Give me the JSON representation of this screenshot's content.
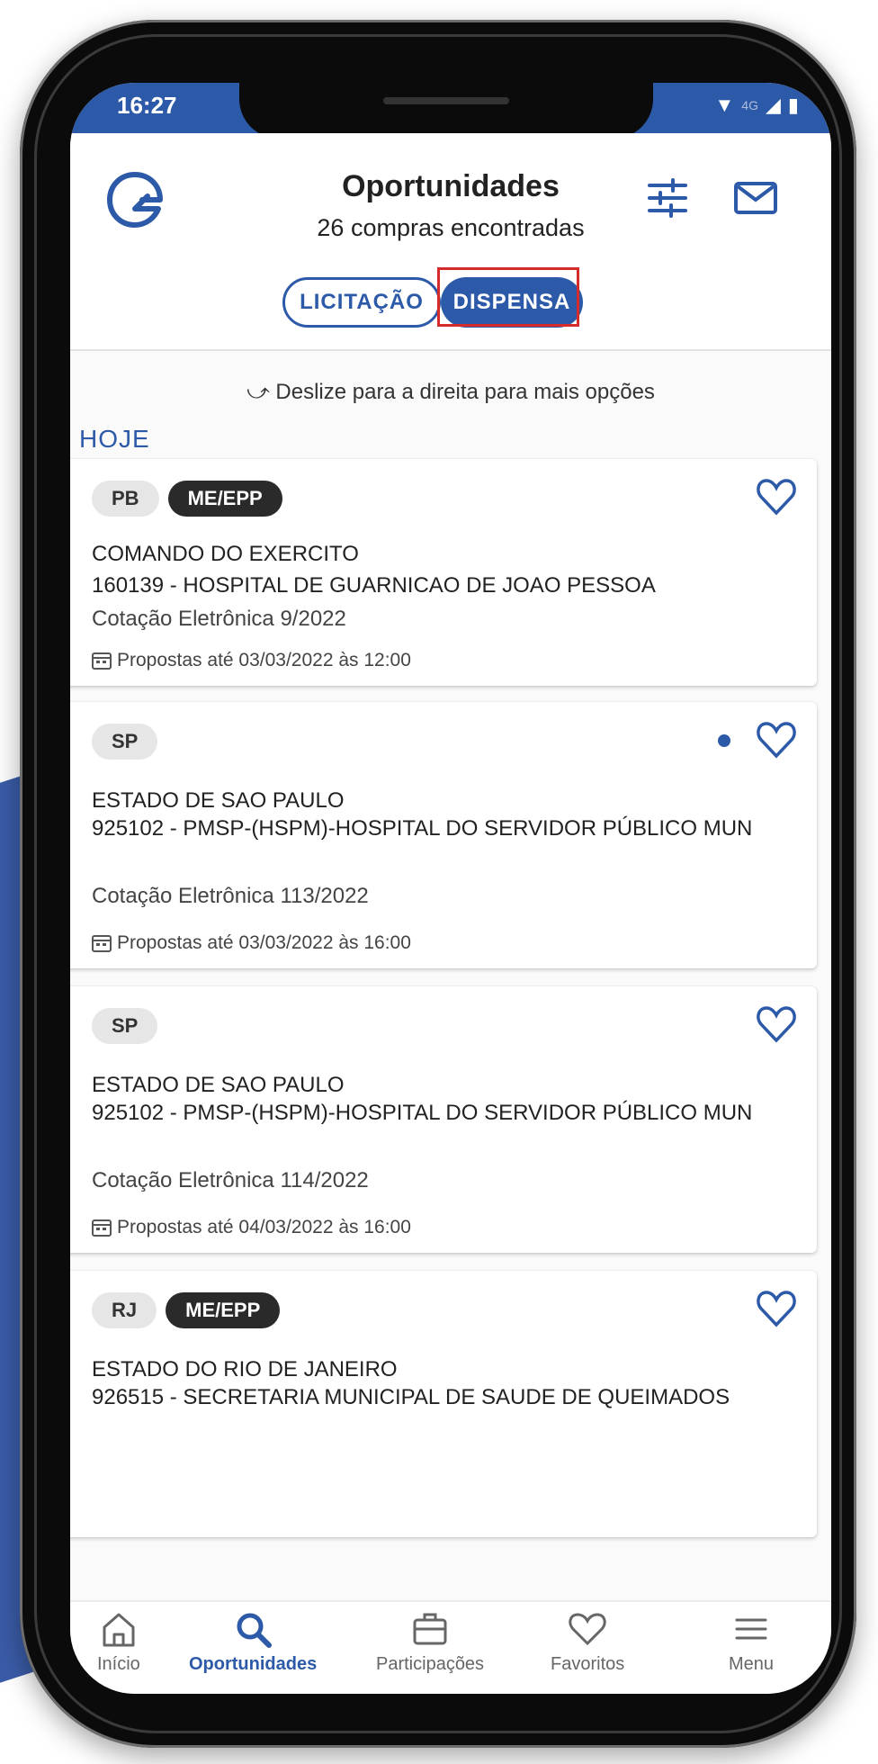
{
  "status_bar": {
    "time": "16:27",
    "network": "4G"
  },
  "header": {
    "title": "Oportunidades",
    "subtitle": "26 compras encontradas",
    "tabs": [
      {
        "label": "LICITAÇÃO",
        "active": false
      },
      {
        "label": "DISPENSA",
        "active": true
      }
    ]
  },
  "hint": "⤻ Deslize para a direita para mais opções",
  "section": "HOJE",
  "cards": [
    {
      "uf": "PB",
      "tag": "ME/EPP",
      "org": "COMANDO DO EXERCITO",
      "uasg": "160139 - HOSPITAL DE GUARNICAO DE JOAO PESSOA",
      "modality": "Cotação Eletrônica 9/2022",
      "deadline": "Propostas até 03/03/2022 às 12:00",
      "unread": false
    },
    {
      "uf": "SP",
      "tag": "",
      "org": "ESTADO DE SAO PAULO",
      "uasg": "925102 - PMSP-(HSPM)-HOSPITAL DO SERVIDOR PÚBLICO MUN",
      "modality": "Cotação Eletrônica 113/2022",
      "deadline": "Propostas até 03/03/2022 às 16:00",
      "unread": true
    },
    {
      "uf": "SP",
      "tag": "",
      "org": "ESTADO DE SAO PAULO",
      "uasg": "925102 - PMSP-(HSPM)-HOSPITAL DO SERVIDOR PÚBLICO MUN",
      "modality": "Cotação Eletrônica 114/2022",
      "deadline": "Propostas até 04/03/2022 às 16:00",
      "unread": false
    },
    {
      "uf": "RJ",
      "tag": "ME/EPP",
      "org": "ESTADO DO RIO DE JANEIRO",
      "uasg": "926515 - SECRETARIA MUNICIPAL DE SAUDE DE QUEIMADOS",
      "modality": "",
      "deadline": "",
      "unread": false
    }
  ],
  "bottom_nav": [
    {
      "label": "Início",
      "icon": "home-icon",
      "active": false
    },
    {
      "label": "Oportunidades",
      "icon": "search-icon",
      "active": true
    },
    {
      "label": "Participações",
      "icon": "briefcase-icon",
      "active": false
    },
    {
      "label": "Favoritos",
      "icon": "heart-icon",
      "active": false
    },
    {
      "label": "Menu",
      "icon": "menu-icon",
      "active": false
    }
  ],
  "colors": {
    "primary": "#2d5aa8",
    "highlight": "#d62b2b",
    "chip_dark": "#2a2a2a",
    "chip_light": "#e6e6e6"
  }
}
